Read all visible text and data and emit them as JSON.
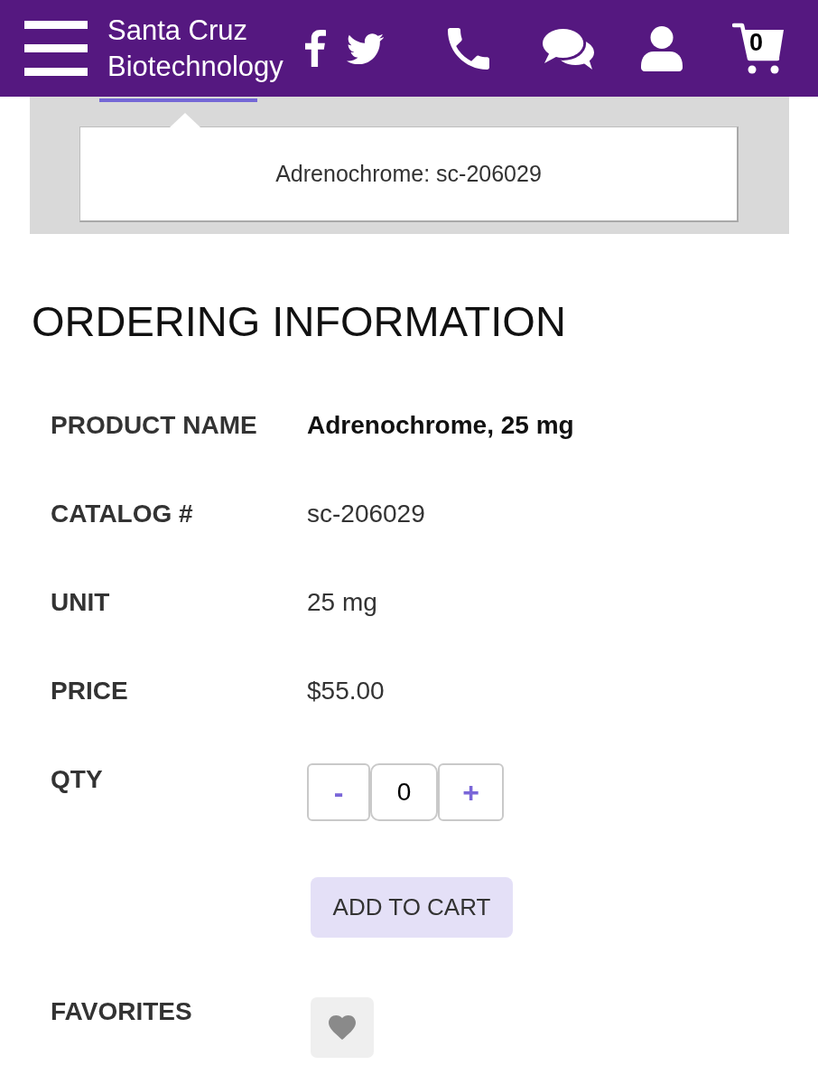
{
  "header": {
    "brand": "Santa Cruz Biotechnology",
    "cart_count": "0"
  },
  "tab_panel": {
    "popover_text": "Adrenochrome: sc-206029"
  },
  "ordering": {
    "title": "ORDERING INFORMATION",
    "rows": [
      {
        "kind": "name",
        "label": "PRODUCT NAME",
        "value": "Adrenochrome, 25 mg"
      },
      {
        "kind": "text",
        "label": "CATALOG #",
        "value": "sc-206029"
      },
      {
        "kind": "text",
        "label": "UNIT",
        "value": "25 mg"
      },
      {
        "kind": "text",
        "label": "PRICE",
        "value": "$55.00"
      },
      {
        "kind": "quantity",
        "label": "QTY",
        "decrement": "-",
        "value": "0",
        "increment": "+"
      },
      {
        "kind": "button",
        "button": "ADD TO CART"
      },
      {
        "kind": "favorite",
        "label": "FAVORITES",
        "favorited": false
      }
    ]
  }
}
